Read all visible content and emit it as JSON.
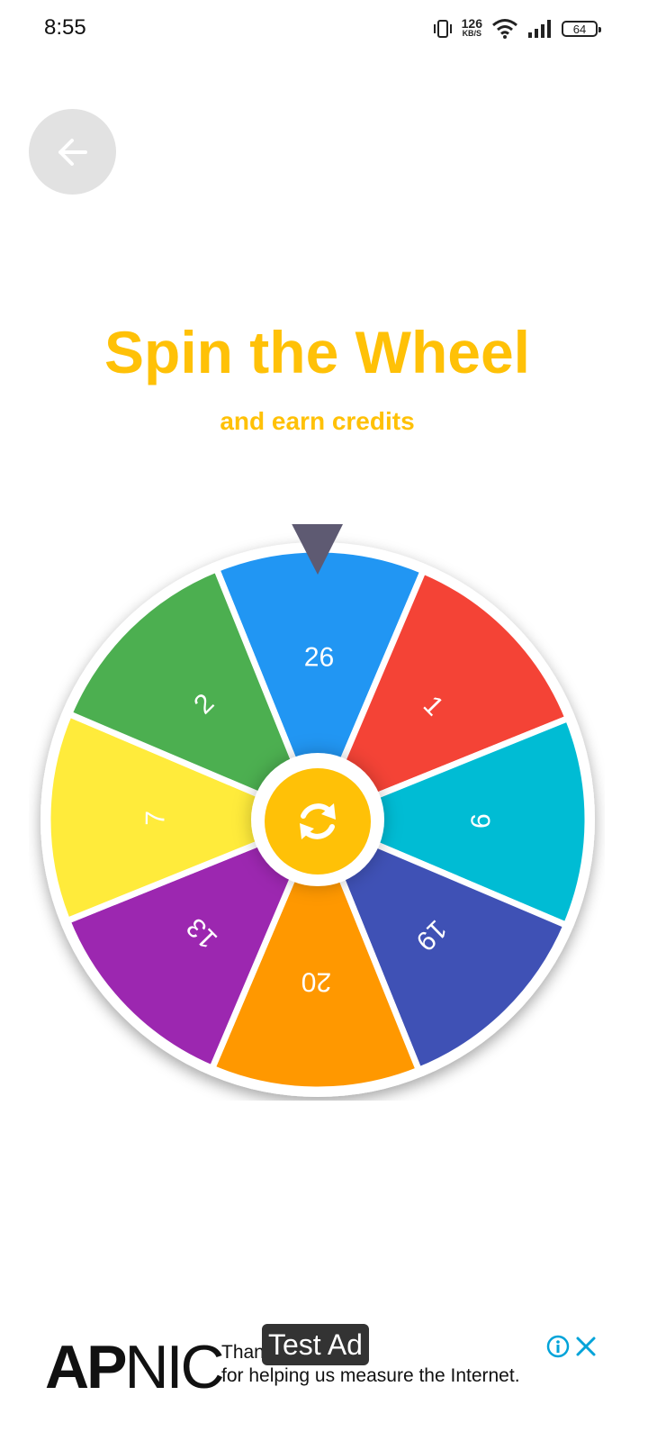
{
  "status_bar": {
    "time": "8:55",
    "net_speed_value": "126",
    "net_speed_unit": "KB/S",
    "battery": "64"
  },
  "back_button": {
    "icon": "arrow-left-icon"
  },
  "header": {
    "title": "Spin the Wheel",
    "subtitle": "and earn credits"
  },
  "wheel": {
    "segments": [
      {
        "label": "26",
        "color": "#2196F3"
      },
      {
        "label": "1",
        "color": "#F44336"
      },
      {
        "label": "9",
        "color": "#00BCD4"
      },
      {
        "label": "19",
        "color": "#3F51B5"
      },
      {
        "label": "20",
        "color": "#FF9800"
      },
      {
        "label": "13",
        "color": "#9C27B0"
      },
      {
        "label": "7",
        "color": "#FFEB3B"
      },
      {
        "label": "2",
        "color": "#4CAF50"
      }
    ],
    "pointer_color": "#5E5A72",
    "spin_icon": "refresh-icon",
    "spin_color": "#FFC107"
  },
  "ad": {
    "logo_bold": "AP",
    "logo_regular": "NIC",
    "line1": "Than",
    "line2": "for helping us measure the Internet.",
    "badge": "Test Ad",
    "info_icon": "info-icon",
    "close_icon": "close-icon",
    "accent": "#00A3D9"
  }
}
